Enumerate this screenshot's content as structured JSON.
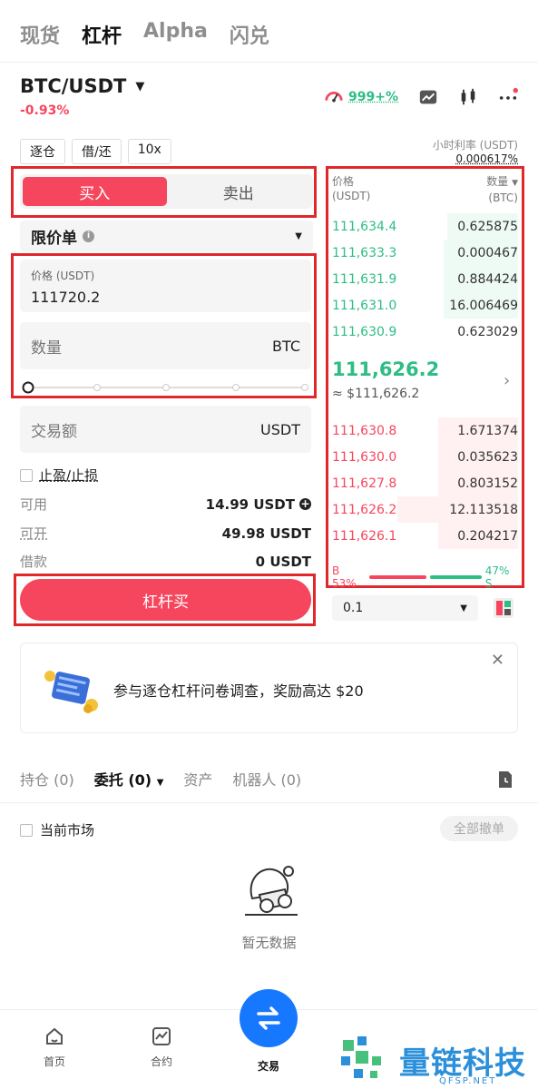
{
  "top_tabs": [
    "现货",
    "杠杆",
    "Alpha",
    "闪兑"
  ],
  "pair": {
    "symbol": "BTC/USDT",
    "change": "-0.93%",
    "score": "999+%"
  },
  "chips": [
    "逐仓",
    "借/还",
    "10x"
  ],
  "rate": {
    "label": "小时利率 (USDT)",
    "value": "0.000617%"
  },
  "side": {
    "buy": "买入",
    "sell": "卖出"
  },
  "order_type": "限价单",
  "price_field": {
    "label": "价格 (USDT)",
    "value": "111720.2"
  },
  "qty_field": {
    "placeholder": "数量",
    "unit": "BTC"
  },
  "amount_field": {
    "placeholder": "交易额",
    "unit": "USDT"
  },
  "tpsl_label": "止盈/止损",
  "balances": [
    {
      "label": "可用",
      "value": "14.99 USDT"
    },
    {
      "label": "可开",
      "value": "49.98 USDT"
    },
    {
      "label": "借款",
      "value": "0 USDT"
    }
  ],
  "submit_label": "杠杆买",
  "orderbook": {
    "price_header": "价格",
    "price_unit": "(USDT)",
    "qty_header": "数量",
    "qty_unit": "(BTC)",
    "upper": [
      {
        "price": "111,634.4",
        "qty": "0.625875",
        "depth": 0.38
      },
      {
        "price": "111,633.3",
        "qty": "0.000467",
        "depth": 0.4
      },
      {
        "price": "111,631.9",
        "qty": "0.884424",
        "depth": 0.4
      },
      {
        "price": "111,631.0",
        "qty": "16.006469",
        "depth": 0.4
      },
      {
        "price": "111,630.9",
        "qty": "0.623029",
        "depth": 0.0
      }
    ],
    "mid_price": "111,626.2",
    "mid_fiat": "≈ $111,626.2",
    "lower": [
      {
        "price": "111,630.8",
        "qty": "1.671374",
        "depth": 0.43
      },
      {
        "price": "111,630.0",
        "qty": "0.035623",
        "depth": 0.43
      },
      {
        "price": "111,627.8",
        "qty": "0.803152",
        "depth": 0.43
      },
      {
        "price": "111,626.2",
        "qty": "12.113518",
        "depth": 0.65
      },
      {
        "price": "111,626.1",
        "qty": "0.204217",
        "depth": 0.43
      }
    ],
    "buy_ratio": "B 53%",
    "sell_ratio": "47% S",
    "buy_pct": 53,
    "sell_pct": 47,
    "depth_value": "0.1"
  },
  "banner_text": "参与逐仓杠杆问卷调查，奖励高达 $20",
  "bottom_tabs": [
    "持仓 (0)",
    "委托 (0)",
    "资产",
    "机器人 (0)"
  ],
  "current_market": "当前市场",
  "cancel_all": "全部撤单",
  "empty_text": "暂无数据",
  "nav": {
    "home": "首页",
    "futures": "合约",
    "trade": "交易"
  },
  "brand": {
    "name": "量链科技",
    "sub": "QFSP.NET"
  },
  "colors": {
    "green": "#2ebd85",
    "red": "#f6465d",
    "blue": "#1677ff",
    "annotation": "#e0282c"
  }
}
